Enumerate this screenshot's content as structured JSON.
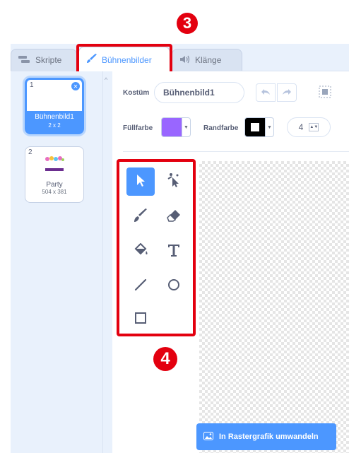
{
  "annotations": {
    "step3": "3",
    "step4": "4"
  },
  "tabs": [
    {
      "label": "Skripte",
      "icon": "code-blocks-icon"
    },
    {
      "label": "Bühnenbilder",
      "icon": "paintbrush-icon",
      "active": true
    },
    {
      "label": "Klänge",
      "icon": "speaker-icon"
    }
  ],
  "costumes": [
    {
      "number": "1",
      "name": "Bühnenbild1",
      "size": "2 x 2",
      "selected": true
    },
    {
      "number": "2",
      "name": "Party",
      "size": "504 x 381",
      "selected": false
    }
  ],
  "toolbar": {
    "costume_label": "Kostüm",
    "costume_name": "Bühnenbild1",
    "fill_label": "Füllfarbe",
    "outline_label": "Randfarbe",
    "outline_width": "4"
  },
  "colors": {
    "fill": "#9966ff",
    "outline": "#000000",
    "accent": "#4c97ff",
    "highlight": "#e3000f"
  },
  "tools": [
    "select-icon",
    "reshape-icon",
    "brush-icon",
    "eraser-icon",
    "fill-icon",
    "text-icon",
    "line-icon",
    "circle-icon",
    "rectangle-icon"
  ],
  "convert_button": {
    "label": "In Rastergrafik umwandeln",
    "icon": "image-icon"
  }
}
